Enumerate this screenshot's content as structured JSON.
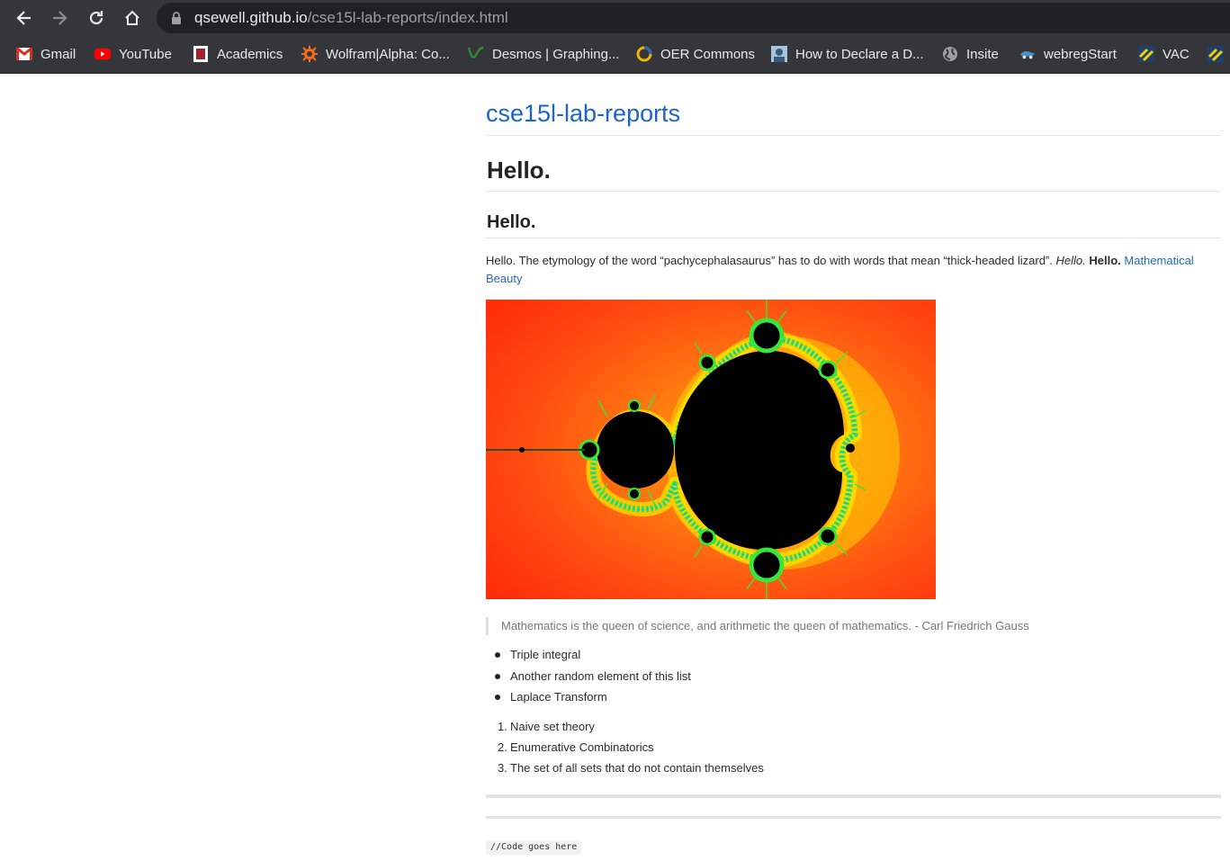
{
  "browser": {
    "url_host": "qsewell.github.io",
    "url_path": "/cse15l-lab-reports/index.html",
    "bookmarks": [
      {
        "label": "Gmail",
        "icon": "gmail-icon"
      },
      {
        "label": "YouTube",
        "icon": "youtube-icon"
      },
      {
        "label": "Academics",
        "icon": "academics-icon"
      },
      {
        "label": "Wolfram|Alpha: Co...",
        "icon": "wolfram-icon"
      },
      {
        "label": "Desmos | Graphing...",
        "icon": "desmos-icon"
      },
      {
        "label": "OER Commons",
        "icon": "oer-icon"
      },
      {
        "label": "How to Declare a D...",
        "icon": "declare-icon"
      },
      {
        "label": "Insite",
        "icon": "globe-icon"
      },
      {
        "label": "webregStart",
        "icon": "webreg-icon"
      },
      {
        "label": "VAC",
        "icon": "vac-icon"
      }
    ]
  },
  "page": {
    "site_title": "cse15l-lab-reports",
    "h1": "Hello.",
    "h2": "Hello.",
    "paragraph": {
      "text": "Hello. The etymology of the word “pachycephalasaurus” has to do with words that mean “thick-headed lizard”. ",
      "italic": "Hello.",
      "bold": "Hello.",
      "link": "Mathematical Beauty"
    },
    "quote": "Mathematics is the queen of science, and arithmetic the queen of mathematics. - Carl Friedrich Gauss",
    "unordered_list": [
      "Triple integral",
      "Another random element of this list",
      "Laplace Transform"
    ],
    "ordered_list": [
      "Naive set theory",
      "Enumerative Combinatorics",
      "The set of all sets that do not contain themselves"
    ],
    "ordered_numbers": [
      "1.",
      "2.",
      "3."
    ],
    "code": "//Code goes here"
  },
  "colors": {
    "chrome": "#35363a",
    "omnibox": "#202124",
    "link": "#1c64c8"
  }
}
